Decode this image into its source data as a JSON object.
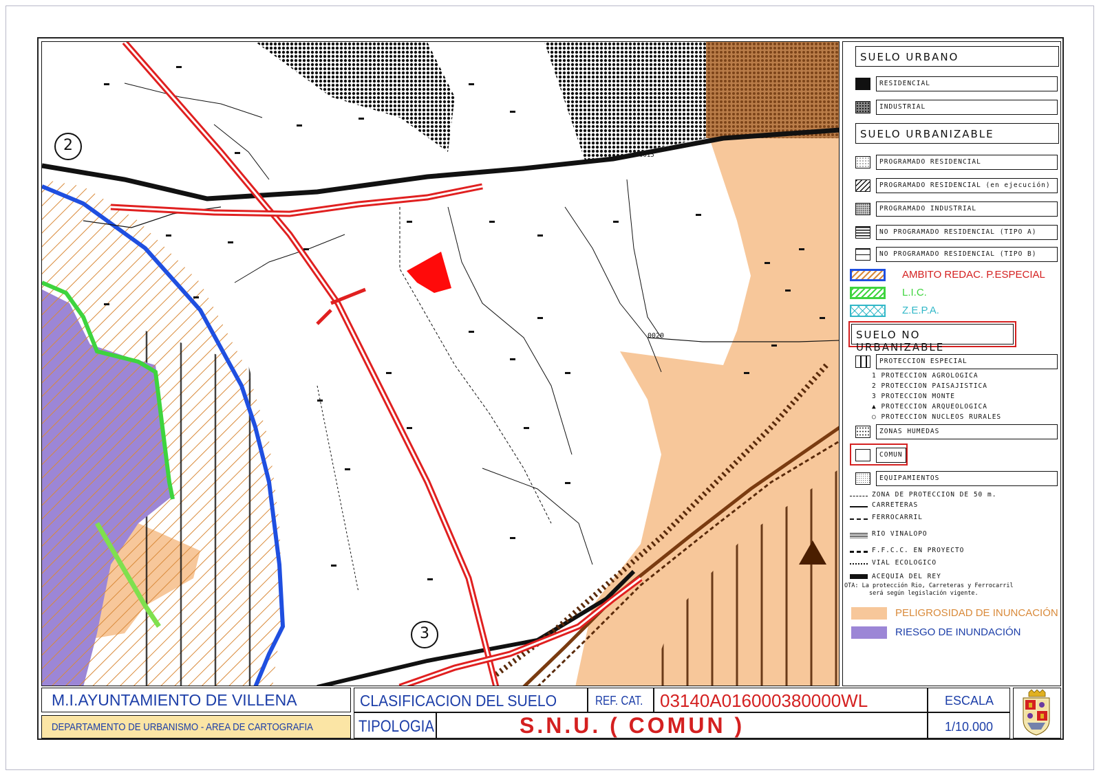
{
  "colors": {
    "road_red": "#e02020",
    "river_blue": "#1f4fe0",
    "lic_green": "#3ed43e",
    "zepa_cyan": "#32b8c8",
    "flood_hazard": "#f7c79a",
    "flood_risk": "#9c86d6",
    "rail_brown": "#7a3b10",
    "title_blue": "#1c3ea8",
    "title_red": "#d42020"
  },
  "map_labels": {
    "sheet_marker_top": "2",
    "sheet_marker_bottom": "3",
    "road_code_top": "0015",
    "road_code_mid": "0020"
  },
  "legend": {
    "suelo_urbano": {
      "heading": "SUELO URBANO",
      "items": [
        "RESIDENCIAL",
        "INDUSTRIAL"
      ]
    },
    "suelo_urbanizable": {
      "heading": "SUELO URBANIZABLE",
      "items": [
        "PROGRAMADO RESIDENCIAL",
        "PROGRAMADO RESIDENCIAL (en ejecución)",
        "PROGRAMADO INDUSTRIAL",
        "NO PROGRAMADO RESIDENCIAL (TIPO A)",
        "NO PROGRAMADO RESIDENCIAL (TIPO B)"
      ]
    },
    "overlays": {
      "ambito": "AMBITO REDAC. P.ESPECIAL",
      "lic": "L.I.C.",
      "zepa": "Z.E.P.A."
    },
    "suelo_no_urbanizable": {
      "heading": "SUELO NO URBANIZABLE",
      "proteccion_especial": "PROTECCION ESPECIAL",
      "sub_items": [
        "1 PROTECCION AGROLOGICA",
        "2 PROTECCION PAISAJISTICA",
        "3 PROTECCION MONTE",
        "▲ PROTECCION ARQUEOLOGICA",
        "○ PROTECCION NUCLEOS RURALES"
      ],
      "zonas_humedas": "ZONAS HUMEDAS",
      "comun": "COMUN",
      "equipamientos": "EQUIPAMIENTOS"
    },
    "lines": [
      "ZONA DE PROTECCION DE 50 m.",
      "CARRETERAS",
      "FERROCARRIL",
      "RIO VINALOPO",
      "F.F.C.C. EN PROYECTO",
      "VIAL ECOLOGICO",
      "ACEQUIA DEL REY"
    ],
    "note_line1": "OTA: La protección Rio, Carreteras y Ferrocarril",
    "note_line2": "será según legislación vigente.",
    "flood": {
      "peligrosidad": "PELIGROSIDAD DE INUNCACIÓN",
      "riesgo": "RIESGO DE INUNDACIÓN"
    }
  },
  "title_block": {
    "ayuntamiento": "M.I.AYUNTAMIENTO DE VILLENA",
    "departamento": "DEPARTAMENTO DE URBANISMO - AREA DE CARTOGRAFIA",
    "clasificacion": "CLASIFICACION DEL SUELO",
    "ref_cat_label": "REF. CAT.",
    "ref_cat_value": "03140A016000380000WL",
    "escala_label": "ESCALA",
    "escala_value": "1/10.000",
    "tipologia_label": "TIPOLOGIA",
    "tipologia_value": "S.N.U. ( COMUN )"
  }
}
